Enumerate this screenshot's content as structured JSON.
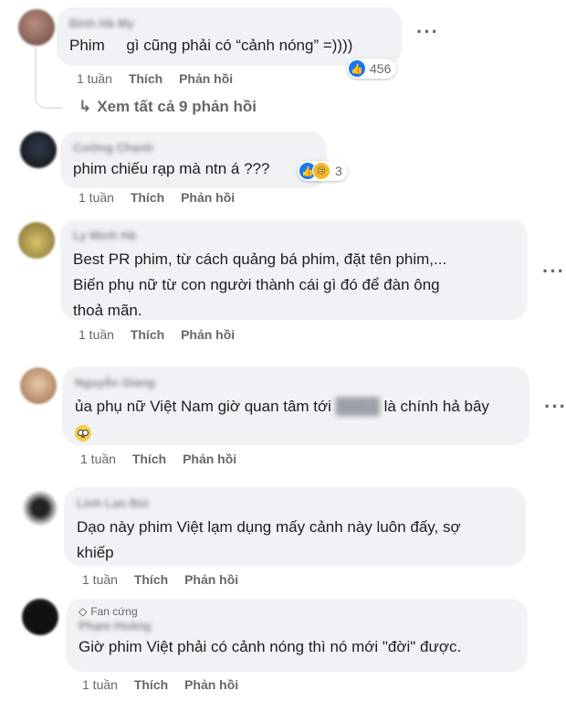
{
  "comments": [
    {
      "text": "Phim     gì cũng phải có “cảnh nóng” =))))",
      "time": "1 tuần",
      "like": "Thích",
      "reply": "Phản hồi",
      "reaction_count": "456",
      "view_all": "Xem tất cả 9 phản hồi"
    },
    {
      "text": "phim chiếu rạp mà ntn á ???",
      "time": "1 tuần",
      "like": "Thích",
      "reply": "Phản hồi",
      "reaction_count": "3"
    },
    {
      "text": "Best PR phim, từ cách quảng bá phim, đặt tên phim,...\nBiến phụ nữ từ con người thành cái gì đó để đàn ông\nthoả mãn.",
      "time": "1 tuần",
      "like": "Thích",
      "reply": "Phản hồi"
    },
    {
      "text_before": "ủa phụ nữ Việt Nam giờ quan tâm tới ",
      "text_after": " là chính hả bây",
      "time": "1 tuần",
      "like": "Thích",
      "reply": "Phản hồi"
    },
    {
      "text": "Dạo này phim Việt lạm dụng mấy cảnh này luôn đấy, sợ\nkhiếp",
      "time": "1 tuần",
      "like": "Thích",
      "reply": "Phản hồi"
    },
    {
      "badge": "Fan cứng",
      "text": "Giờ phim Việt phải có cảnh nóng thì nó mới \"đời\" được.",
      "time": "1 tuần",
      "like": "Thích",
      "reply": "Phản hồi"
    }
  ],
  "icons": {
    "more": "more-options-icon",
    "reply_arrow": "reply-arrow-icon",
    "like_reaction": "like-reaction-icon",
    "sad_reaction": "sad-reaction-icon",
    "fan_badge": "diamond-icon",
    "flushed_emoji": "flushed-face-emoji"
  },
  "colors": {
    "bubble": "#f0f2f5",
    "like_blue": "#1877f2",
    "meta_gray": "#65676b"
  }
}
